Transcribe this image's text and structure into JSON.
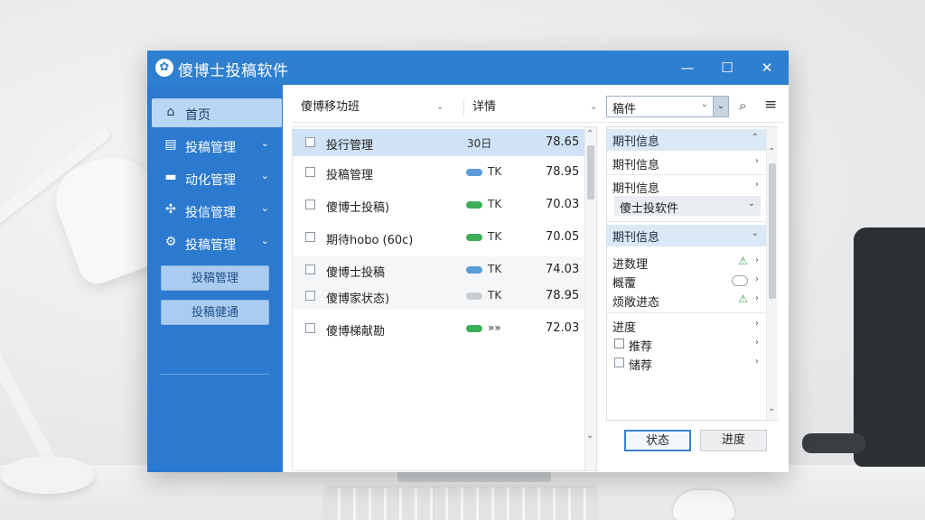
{
  "window": {
    "title": "傻博士投稿软件",
    "logo_glyph": "✿",
    "controls": {
      "minimize": "—",
      "maximize": "☐",
      "close": "✕"
    }
  },
  "sidebar": {
    "items": [
      {
        "label": "首页",
        "icon": "home-icon",
        "glyph": "⌂",
        "active": true
      },
      {
        "label": "投稿管理",
        "icon": "document-icon",
        "glyph": "▤",
        "chevron": "⌄"
      },
      {
        "label": "动化管理",
        "icon": "folder-icon",
        "glyph": "▬",
        "chevron": "⌄"
      },
      {
        "label": "投信管理",
        "icon": "puzzle-icon",
        "glyph": "✣",
        "chevron": "⌄"
      },
      {
        "label": "投稿管理",
        "icon": "gear-icon",
        "glyph": "⚙",
        "chevron": "⌄"
      }
    ],
    "sub_buttons": [
      "投稿管理",
      "投稿健通"
    ]
  },
  "toolbar": {
    "field1": "傻博移功班",
    "field1_caret": "⌄",
    "field2": "详情",
    "field2_caret": "⌄",
    "select_value": "稿件",
    "select_caret": "⌄",
    "search_glyph": "⌕",
    "menu_glyph": "≡"
  },
  "list": {
    "rows": [
      {
        "name": "投行管理",
        "tag": "30日",
        "value": "78.65",
        "pill": null,
        "selected": true
      },
      {
        "name": "投稿管理",
        "tag": "TK",
        "value": "78.95",
        "pill": "#5b9bd8"
      },
      {
        "name": "傻博士投稿)",
        "tag": "TK",
        "value": "70.03",
        "pill": "#3cae5a",
        "arrow": true
      },
      {
        "name": "期待hobo (60c)",
        "tag": "TK",
        "value": "70.05",
        "pill": "#3cae5a",
        "arrow": true
      },
      {
        "name": "傻博士投稿",
        "tag": "TK",
        "value": "74.03",
        "pill": "#5b9bd8",
        "alt": true
      },
      {
        "name": "傻博家状态)",
        "tag": "TK",
        "value": "78.95",
        "pill": "#c9ccd0",
        "alt": true
      },
      {
        "name": "傻博梯献勘",
        "tag": "»»",
        "value": "72.03",
        "pill": "#3cae5a"
      }
    ],
    "scroll_down_glyph": "⌄",
    "scroll_up_glyph": "⌃"
  },
  "rpanel": {
    "header1": "期刊信息",
    "header1_caret": "⌃",
    "items1": [
      "期刊信息",
      "期刊信息"
    ],
    "dropdown": "傻士投软件",
    "header2": "期刊信息",
    "header2_caret": "⌄",
    "items2": [
      "进数理",
      "概覆",
      "烦敞进态"
    ],
    "items3": [
      "进度",
      "推荐",
      "储荐"
    ],
    "chev": "›",
    "warn_glyph": "⚠",
    "colors": {
      "warn": "#3aa54a",
      "accent": "#2f7fd0"
    }
  },
  "footer": {
    "primary": "状态",
    "secondary": "进度"
  }
}
